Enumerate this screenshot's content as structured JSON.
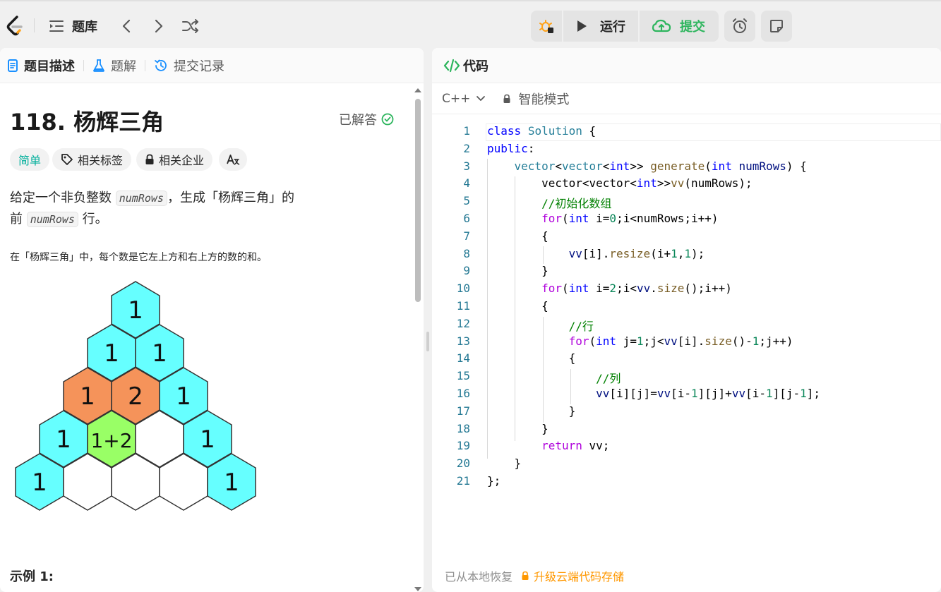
{
  "topbar": {
    "problem_list_label": "题库",
    "run_label": "运行",
    "submit_label": "提交"
  },
  "left": {
    "tabs": [
      {
        "label": "题目描述"
      },
      {
        "label": "题解"
      },
      {
        "label": "提交记录"
      }
    ],
    "title": "118. 杨辉三角",
    "solved_label": "已解答",
    "chips": {
      "difficulty": "简单",
      "tags": "相关标签",
      "companies": "相关企业"
    },
    "desc_line1_a": "给定一个非负整数 ",
    "desc_code": "numRows",
    "desc_line1_b": "，生成「杨辉三角」的",
    "desc_line2_a": "前 ",
    "desc_line2_b": " 行。",
    "small_desc": "在「杨辉三角」中，每个数是它左上方和右上方的数的和。",
    "example_label": "示例 1:",
    "triangle": {
      "row1": [
        "1"
      ],
      "row2": [
        "1",
        "1"
      ],
      "row3": [
        "1",
        "2",
        "1"
      ],
      "row4": [
        "1",
        "1+2",
        "",
        "1"
      ],
      "row5": [
        "1",
        "",
        "",
        "",
        "1"
      ],
      "colors": {
        "cyan": "#66ffff",
        "orange": "#f5935a",
        "green": "#99ff66",
        "white": "#ffffff"
      }
    }
  },
  "right": {
    "panel_title": "代码",
    "language": "C++",
    "mode_label": "智能模式",
    "footer_restored": "已从本地恢复",
    "footer_upgrade": "升级云端代码存储",
    "line_numbers": [
      "1",
      "2",
      "3",
      "4",
      "5",
      "6",
      "7",
      "8",
      "9",
      "10",
      "11",
      "12",
      "13",
      "14",
      "15",
      "16",
      "17",
      "18",
      "19",
      "20",
      "21"
    ]
  },
  "colors": {
    "accent_green": "#2db55d",
    "footer_orange": "#ff9800"
  }
}
